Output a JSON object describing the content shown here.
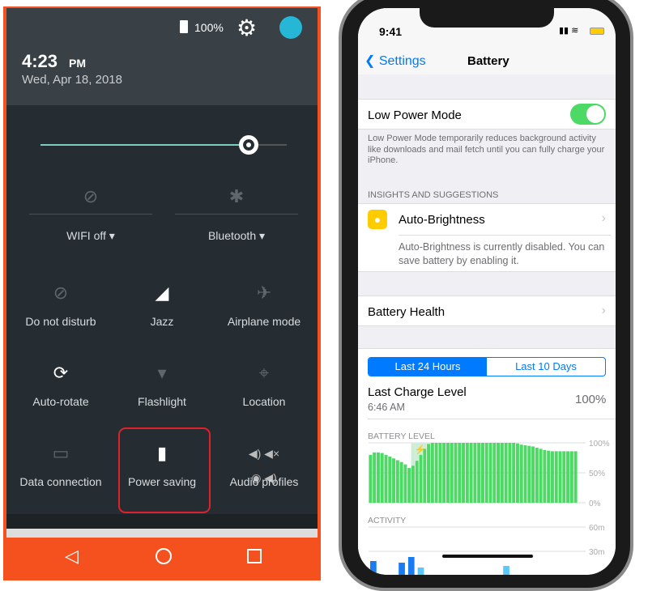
{
  "android": {
    "battery_percent": "100%",
    "time": "4:23",
    "ampm": "PM",
    "date": "Wed, Apr 18, 2018",
    "brightness_level": 0.83,
    "accent": "#80cbc4",
    "nav_color": "#f4511e",
    "toggles": [
      {
        "label": "WIFI off",
        "icon": "wifi-off-icon"
      },
      {
        "label": "Bluetooth",
        "icon": "bluetooth-off-icon"
      }
    ],
    "tiles": [
      {
        "label": "Do not disturb",
        "icon": "do-not-disturb-icon",
        "active": false
      },
      {
        "label": "Jazz",
        "icon": "cell-signal-icon",
        "active": true
      },
      {
        "label": "Airplane mode",
        "icon": "airplane-icon",
        "active": false
      },
      {
        "label": "Auto-rotate",
        "icon": "auto-rotate-icon",
        "active": true
      },
      {
        "label": "Flashlight",
        "icon": "flashlight-icon",
        "active": false
      },
      {
        "label": "Location",
        "icon": "location-off-icon",
        "active": false
      },
      {
        "label": "Data connection",
        "icon": "data-connection-icon",
        "active": false
      },
      {
        "label": "Power saving",
        "icon": "battery-saver-icon",
        "active": true,
        "highlighted": true
      },
      {
        "label": "Audio profiles",
        "icon": "audio-profiles-icon",
        "active": true
      }
    ]
  },
  "ios": {
    "status_time": "9:41",
    "back_label": "Settings",
    "title": "Battery",
    "low_power_label": "Low Power Mode",
    "low_power_on": true,
    "low_power_footer": "Low Power Mode temporarily reduces background activity like downloads and mail fetch until you can fully charge your iPhone.",
    "insights_header": "INSIGHTS AND SUGGESTIONS",
    "auto_brightness_label": "Auto-Brightness",
    "auto_brightness_desc": "Auto-Brightness is currently disabled. You can save battery by enabling it.",
    "battery_health_label": "Battery Health",
    "segments": [
      "Last 24 Hours",
      "Last 10 Days"
    ],
    "selected_segment": 0,
    "last_charge_label": "Last Charge Level",
    "last_charge_time": "6:46 AM",
    "last_charge_value": "100%",
    "battery_level_label": "BATTERY LEVEL",
    "activity_label": "ACTIVITY"
  },
  "chart_data": [
    {
      "type": "bar",
      "title": "BATTERY LEVEL",
      "ylim": [
        0,
        100
      ],
      "yticks": [
        "100%",
        "50%",
        "0%"
      ],
      "values": [
        80,
        84,
        84,
        83,
        80,
        77,
        74,
        71,
        68,
        64,
        58,
        62,
        70,
        80,
        90,
        98,
        100,
        100,
        100,
        100,
        100,
        100,
        100,
        100,
        100,
        100,
        100,
        100,
        100,
        100,
        100,
        100,
        100,
        100,
        100,
        100,
        100,
        100,
        99,
        97,
        96,
        95,
        94,
        92,
        90,
        88,
        87,
        86,
        86,
        86,
        86,
        86,
        86,
        86
      ],
      "charging_range": [
        11,
        15
      ],
      "color": "#4cd964"
    },
    {
      "type": "bar",
      "title": "ACTIVITY",
      "yticks": [
        "60m",
        "30m"
      ],
      "series": [
        {
          "values": [
            18,
            0,
            0,
            16,
            23,
            10,
            0,
            0,
            0,
            0,
            0,
            0,
            0,
            0,
            12,
            0,
            0,
            0,
            0,
            0,
            0,
            0
          ]
        }
      ],
      "color": "#1a7cf2"
    }
  ]
}
